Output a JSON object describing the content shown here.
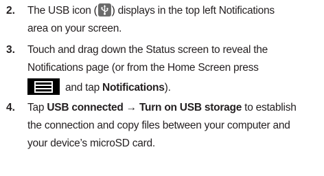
{
  "steps": [
    {
      "number": "2.",
      "line1_pre": "The USB icon (",
      "usb_icon": "usb-icon",
      "line1_post": ") displays in the top left Notifications",
      "line2": "area on your screen."
    },
    {
      "number": "3.",
      "line1": "Touch and drag down the Status screen to reveal the",
      "line2": "Notifications page (or from the Home Screen press",
      "menu_icon": "menu-icon",
      "line3_pre": "and tap ",
      "line3_bold": "Notifications",
      "line3_post": ")."
    },
    {
      "number": "4.",
      "line1_pre": "Tap ",
      "line1_bold": "USB connected → Turn on USB storage",
      "line1_post": " to establish",
      "line2": "the connection and copy files between your computer and",
      "line3": "your device’s microSD card."
    }
  ]
}
